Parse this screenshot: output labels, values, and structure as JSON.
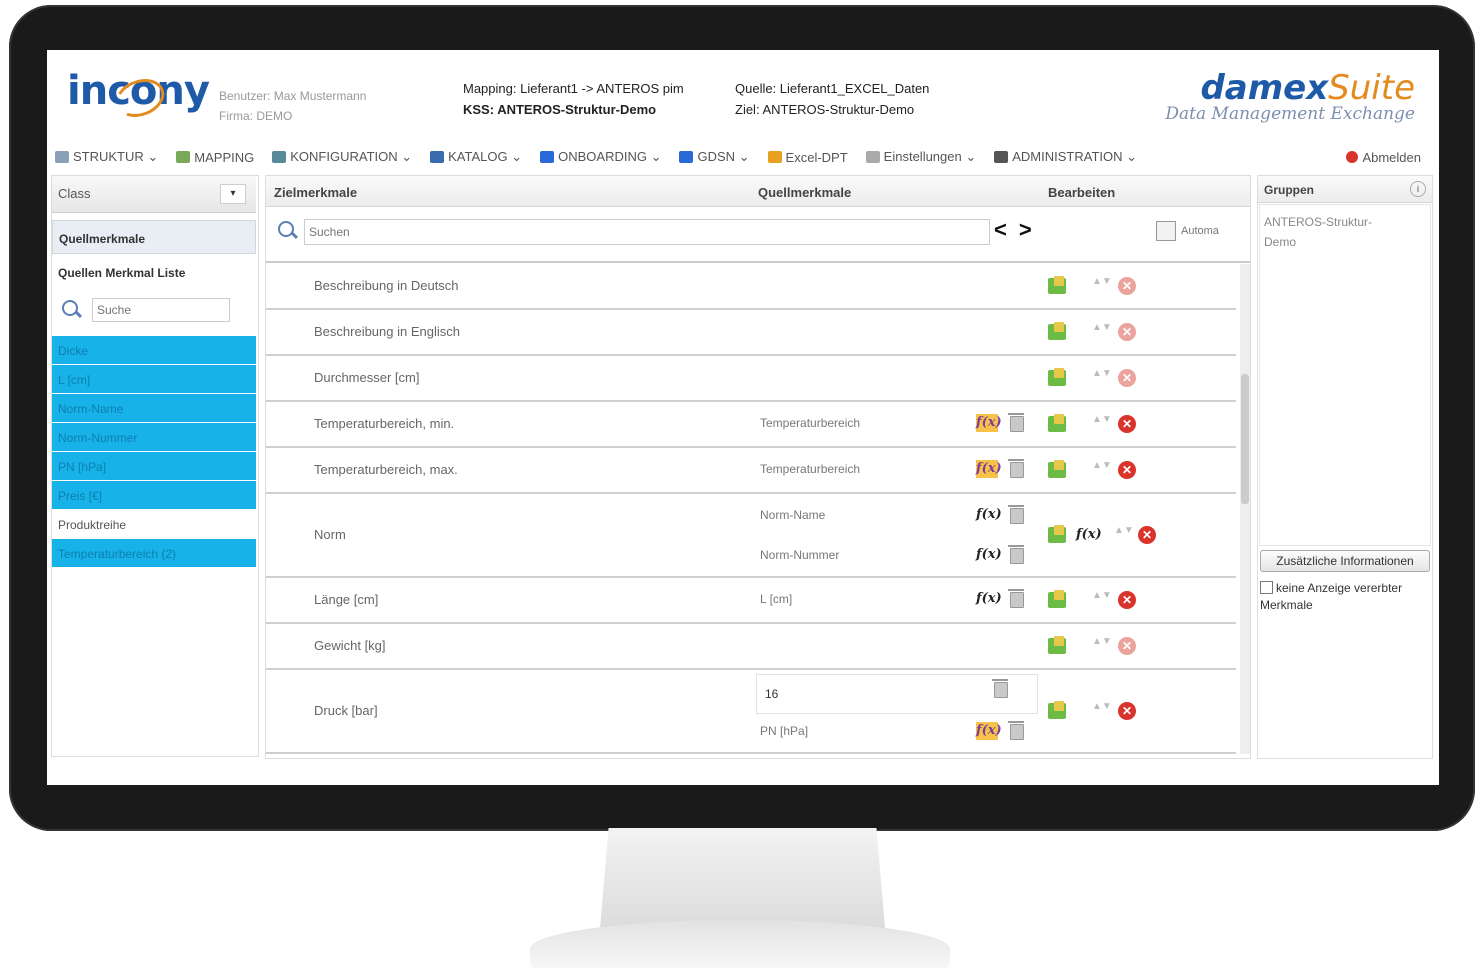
{
  "header": {
    "user_label": "Benutzer: Max Mustermann",
    "company_label": "Firma: DEMO",
    "mapping": "Mapping: Lieferant1 -> ANTEROS pim",
    "kss": "KSS: ANTEROS-Struktur-Demo",
    "source": "Quelle: Lieferant1_EXCEL_Daten",
    "target": "Ziel: ANTEROS-Struktur-Demo",
    "logo_text": "incony",
    "brand_main": "damex",
    "brand_accent": "Suite",
    "brand_sub": "Data Management Exchange"
  },
  "menu": {
    "items": [
      {
        "label": "STRUKTUR ⌄",
        "icon": "structure-icon",
        "color": "#8aa0b8"
      },
      {
        "label": "MAPPING",
        "icon": "mapping-icon",
        "color": "#7aa85a"
      },
      {
        "label": "KONFIGURATION ⌄",
        "icon": "config-icon",
        "color": "#5a8a9a"
      },
      {
        "label": "KATALOG ⌄",
        "icon": "catalog-icon",
        "color": "#3a6ab0"
      },
      {
        "label": "ONBOARDING ⌄",
        "icon": "onboarding-icon",
        "color": "#2a6ad8"
      },
      {
        "label": "GDSN ⌄",
        "icon": "gdsn-icon",
        "color": "#2a6ad8"
      },
      {
        "label": "Excel-DPT",
        "icon": "excel-icon",
        "color": "#e8a020"
      },
      {
        "label": "Einstellungen ⌄",
        "icon": "settings-icon",
        "color": "#aaaaaa"
      },
      {
        "label": "ADMINISTRATION ⌄",
        "icon": "admin-icon",
        "color": "#555555"
      }
    ],
    "logout": "Abmelden"
  },
  "left": {
    "class_label": "Class",
    "tab": "Quellmerkmale",
    "list_title": "Quellen Merkmal Liste",
    "search_placeholder": "Suche",
    "items": [
      {
        "label": "Dicke",
        "selected": true
      },
      {
        "label": "L [cm]",
        "selected": true
      },
      {
        "label": "Norm-Name",
        "selected": true
      },
      {
        "label": "Norm-Nummer",
        "selected": true
      },
      {
        "label": "PN [hPa]",
        "selected": true
      },
      {
        "label": "Preis [€]",
        "selected": true
      },
      {
        "label": "Produktreihe",
        "selected": false
      },
      {
        "label": "Temperaturbereich (2)",
        "selected": true
      }
    ]
  },
  "center": {
    "col_target": "Zielmerkmale",
    "col_source": "Quellmerkmale",
    "col_edit": "Bearbeiten",
    "search_placeholder": "Suchen",
    "autom": "Automa",
    "rows": [
      {
        "target": "Beschreibung in Deutsch",
        "sources": []
      },
      {
        "target": "Beschreibung in Englisch",
        "sources": []
      },
      {
        "target": "Durchmesser [cm]",
        "sources": []
      },
      {
        "target": "Temperaturbereich, min.",
        "sources": [
          "Temperaturbereich"
        ]
      },
      {
        "target": "Temperaturbereich, max.",
        "sources": [
          "Temperaturbereich"
        ]
      },
      {
        "target": "Norm",
        "sources": [
          "Norm-Name",
          "Norm-Nummer"
        ]
      },
      {
        "target": "Länge [cm]",
        "sources": [
          "L [cm]"
        ]
      },
      {
        "target": "Gewicht [kg]",
        "sources": []
      },
      {
        "target": "Druck [bar]",
        "sources": [
          "PN [hPa]"
        ],
        "fixed_value": "16"
      }
    ]
  },
  "right": {
    "title": "Gruppen",
    "group": "ANTEROS-Struktur-Demo",
    "button": "Zusätzliche Informationen",
    "checkbox_label": "keine Anzeige vererbter Merkmale"
  }
}
